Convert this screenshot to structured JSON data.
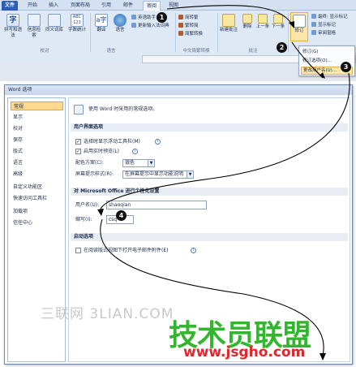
{
  "ribbon": {
    "tabs": [
      "文件",
      "开始",
      "插入",
      "页面布局",
      "引用",
      "邮件",
      "审阅",
      "视图"
    ],
    "proofing": {
      "buttons": [
        "拼写和语法",
        "信息检索",
        "同义词库",
        "字数统计"
      ],
      "group_label": "校对"
    },
    "language": {
      "buttons": [
        "翻译",
        "语言"
      ],
      "group_label": "语言"
    },
    "chinese_conv": {
      "rows": [
        "简转繁",
        "繁转简",
        "简繁转换"
      ],
      "left_rows": [
        "英语助手",
        "更新输入法词典"
      ],
      "group_label": "中文简繁转换"
    },
    "comments": {
      "buttons": [
        "新建批注",
        "删除",
        "上一条",
        "下一条"
      ],
      "group_label": "批注"
    },
    "tracking": {
      "track_button": "修订",
      "rows": [
        "最终: 显示标记",
        "显示标记",
        "审阅窗格"
      ]
    }
  },
  "track_menu": {
    "items": [
      "修订(G)",
      "修订选项(O)...",
      "更改用户名(U)..."
    ]
  },
  "dialog": {
    "title": "Word 选项",
    "nav": [
      "常规",
      "显示",
      "校对",
      "保存",
      "版式",
      "语言",
      "高级",
      "自定义功能区",
      "快速访问工具栏",
      "加载项",
      "信任中心"
    ],
    "intro": "使用 Word 时采用的常规选项。",
    "ui_section": "用户界面选项",
    "ui_options": {
      "mini_toolbar": "选择时显示浮动工具栏(M)",
      "live_preview": "启用实时预览(L)",
      "color_scheme_label": "配色方案(C):",
      "color_scheme_value": "银色",
      "screentip_label": "屏幕提示样式(R):",
      "screentip_value": "在屏幕提示中显示功能说明"
    },
    "personalize_section": "对 Microsoft Office 进行个性化设置",
    "username_label": "用户名(U):",
    "username_value": "shaoqian",
    "initials_label": "缩写(I):",
    "initials_value": "csq",
    "startup_section": "启动选项",
    "startup_option": "在阅读版式视图下打开电子邮件附件(E)"
  },
  "steps": [
    "1",
    "2",
    "3",
    "4"
  ],
  "watermarks": {
    "sanlian": "三联网 3LIAN.COM",
    "site_cn": "技术员联盟",
    "site_url": "www.jsgho.com"
  },
  "colors": {
    "file_tab": "#2a5eb8",
    "menu_highlight": "#fde7a6",
    "nav_selected": "#fcd98c",
    "watermark_green": "#34b52f",
    "watermark_red": "#e3262a"
  }
}
